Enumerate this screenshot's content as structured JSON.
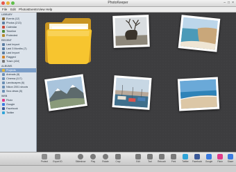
{
  "window": {
    "title": "PhotoKeeper"
  },
  "menu": [
    "File",
    "Edit",
    "Photos",
    "Events",
    "View",
    "Help"
  ],
  "sidebar": {
    "sections": [
      {
        "label": "LIBRARY",
        "items": [
          {
            "label": "Events (12)",
            "color": "#8a6d3b"
          },
          {
            "label": "Photos (213)",
            "color": "#5b7ea3"
          },
          {
            "label": "Calendar",
            "color": "#c94a3c"
          },
          {
            "label": "Timeline",
            "color": "#4f8a3c"
          },
          {
            "label": "Protected",
            "color": "#b58b2a"
          }
        ]
      },
      {
        "label": "RECENT",
        "items": [
          {
            "label": "Last Import",
            "color": "#5b7ea3"
          },
          {
            "label": "Last 3 Months (7)",
            "color": "#5b7ea3"
          },
          {
            "label": "Last Import",
            "color": "#5b7ea3"
          },
          {
            "label": "Flagged",
            "color": "#d3832b"
          },
          {
            "label": "Trash (434)",
            "color": "#777777"
          }
        ]
      },
      {
        "label": "ALBUMS",
        "items": [
          {
            "label": "Projects",
            "color": "#e2b63d",
            "selected": true
          },
          {
            "label": "Animals (8)",
            "color": "#6b8fb5"
          },
          {
            "label": "Cinema (117)",
            "color": "#6b8fb5"
          },
          {
            "label": "Landscapes (6)",
            "color": "#6b8fb5"
          },
          {
            "label": "Nikon 2001 shoots",
            "color": "#6b8fb5"
          },
          {
            "label": "Sea views (8)",
            "color": "#6b8fb5"
          }
        ]
      },
      {
        "label": "WEB",
        "items": [
          {
            "label": "Flickr",
            "color": "#e03a8a"
          },
          {
            "label": "Google",
            "color": "#3a7be0"
          },
          {
            "label": "Facebook",
            "color": "#3b5998"
          },
          {
            "label": "Twitter",
            "color": "#2fa4d8"
          }
        ]
      }
    ],
    "footer": [
      "+",
      "⚙"
    ]
  },
  "toolbar": [
    {
      "label": "Protect",
      "color": "#8c8c8c"
    },
    {
      "label": "Export ID",
      "color": "#8c8c8c"
    },
    {
      "label": "Slideshow",
      "color": "#7a7a7a"
    },
    {
      "label": "Play",
      "color": "#7a7a7a"
    },
    {
      "label": "Rotate",
      "color": "#7a7a7a"
    },
    {
      "label": "Crop",
      "color": "#7a7a7a"
    },
    {
      "label": "Edit",
      "color": "#7a7a7a"
    },
    {
      "label": "Tool",
      "color": "#7a7a7a"
    },
    {
      "label": "Retouch",
      "color": "#7a7a7a"
    },
    {
      "label": "Print",
      "color": "#7a7a7a"
    },
    {
      "label": "Twitter",
      "color": "#2fa4d8"
    },
    {
      "label": "Facebook",
      "color": "#3b5998"
    },
    {
      "label": "Google",
      "color": "#3a7be0"
    },
    {
      "label": "Flickr",
      "color": "#e03a8a"
    },
    {
      "label": "Share",
      "color": "#3a7be0"
    }
  ],
  "photos": [
    {
      "name": "photo-deer"
    },
    {
      "name": "photo-beach-cliffs"
    },
    {
      "name": "photo-snowy-mountain"
    },
    {
      "name": "photo-harbor-boats"
    },
    {
      "name": "photo-sandy-beach"
    }
  ]
}
